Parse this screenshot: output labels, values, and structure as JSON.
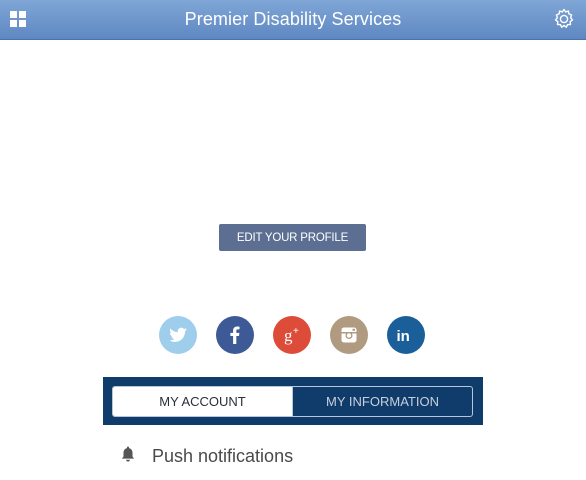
{
  "header": {
    "title": "Premier Disability Services",
    "menu_icon": "grid-icon",
    "settings_icon": "gear-icon",
    "background": "#6d95cc"
  },
  "profile": {
    "edit_button_label": "EDIT YOUR PROFILE"
  },
  "social": [
    {
      "name": "twitter",
      "icon": "twitter-icon",
      "color": "#9fcdec"
    },
    {
      "name": "facebook",
      "icon": "facebook-icon",
      "color": "#3d5a96"
    },
    {
      "name": "google-plus",
      "icon": "google-plus-icon",
      "color": "#dd4b39"
    },
    {
      "name": "instagram",
      "icon": "instagram-icon",
      "color": "#b09a80"
    },
    {
      "name": "linkedin",
      "icon": "linkedin-icon",
      "color": "#1b5f9a"
    }
  ],
  "tabs": {
    "account_label": "MY ACCOUNT",
    "information_label": "MY INFORMATION",
    "active": "MY ACCOUNT",
    "bar_color": "#0f3c6a"
  },
  "settings_list": {
    "push_notifications_label": "Push notifications",
    "push_icon": "bell-icon"
  }
}
